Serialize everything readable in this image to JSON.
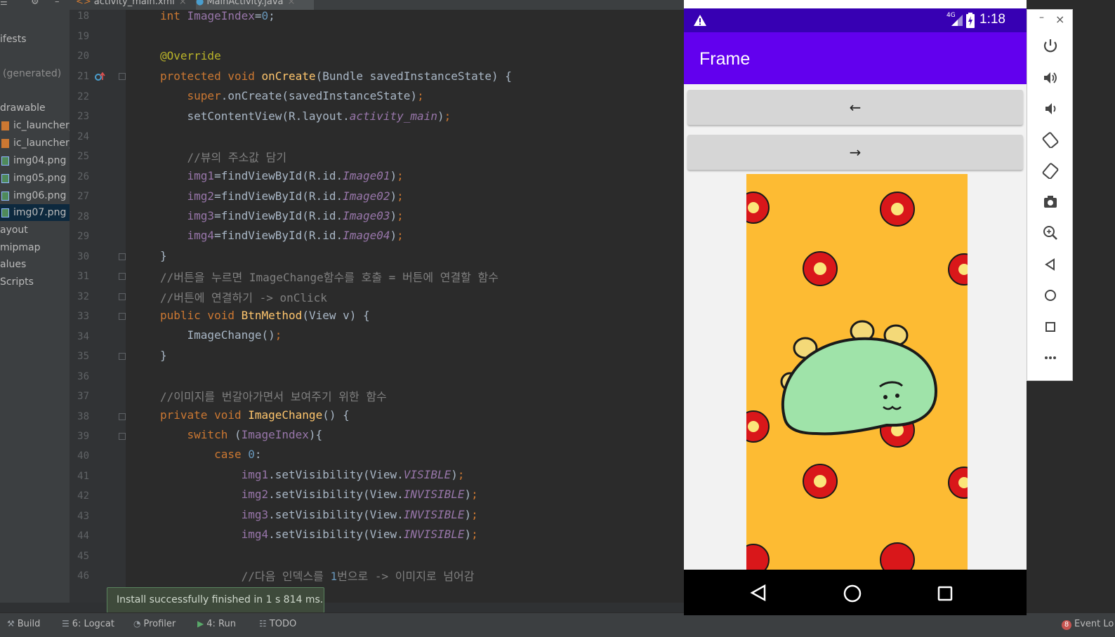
{
  "tabs": [
    {
      "label": "activity_main.xml"
    },
    {
      "label": "MainActivity.java"
    }
  ],
  "project": {
    "items": [
      {
        "label": "ifests"
      },
      {
        "label": "(generated)"
      },
      {
        "label": "drawable"
      },
      {
        "label": "ic_launcher_"
      },
      {
        "label": "ic_launcher_"
      },
      {
        "label": "img04.png"
      },
      {
        "label": "img05.png"
      },
      {
        "label": "img06.png"
      },
      {
        "label": "img07.png"
      },
      {
        "label": "ayout"
      },
      {
        "label": "mipmap"
      },
      {
        "label": "alues"
      },
      {
        "label": "Scripts"
      }
    ]
  },
  "editor": {
    "line_numbers": [
      "18",
      "19",
      "20",
      "21",
      "22",
      "23",
      "24",
      "25",
      "26",
      "27",
      "28",
      "29",
      "30",
      "31",
      "32",
      "33",
      "34",
      "35",
      "36",
      "37",
      "38",
      "39",
      "40",
      "41",
      "42",
      "43",
      "44",
      "45",
      "46"
    ]
  },
  "toast": "Install successfully finished in 1 s 814 ms.",
  "toolwindows": [
    {
      "label": "Build"
    },
    {
      "label": "6: Logcat"
    },
    {
      "label": "Profiler"
    },
    {
      "label": "4: Run"
    },
    {
      "label": "TODO"
    }
  ],
  "event_log": {
    "count": "8",
    "label": "Event Lo"
  },
  "emulator": {
    "status_network": "4G",
    "status_time": "1:18",
    "app_title": "Frame",
    "prev_button": "←",
    "next_button": "→",
    "window_minimize": "–",
    "window_close": "×"
  },
  "colors": {
    "app_bar": "#6200ee",
    "status_bar": "#3700b3",
    "editor_bg": "#2b2b2b"
  }
}
